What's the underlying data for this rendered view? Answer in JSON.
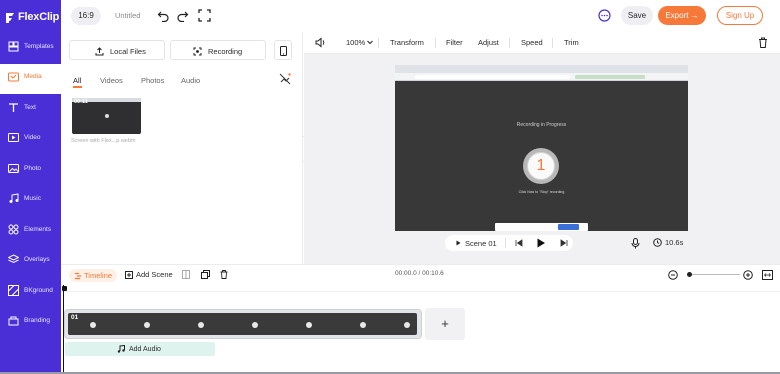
{
  "app": {
    "name": "FlexClip"
  },
  "sidebar": {
    "items": [
      {
        "label": "Templates",
        "icon": "templates-icon"
      },
      {
        "label": "Media",
        "icon": "media-icon"
      },
      {
        "label": "Text",
        "icon": "text-icon"
      },
      {
        "label": "Video",
        "icon": "video-icon"
      },
      {
        "label": "Photo",
        "icon": "photo-icon"
      },
      {
        "label": "Music",
        "icon": "music-icon"
      },
      {
        "label": "Elements",
        "icon": "elements-icon"
      },
      {
        "label": "Overlays",
        "icon": "overlays-icon"
      },
      {
        "label": "BKground",
        "icon": "background-icon"
      },
      {
        "label": "Branding",
        "icon": "branding-icon"
      }
    ],
    "active": "Media"
  },
  "topbar": {
    "ratio": "16:9",
    "title": "Untitled",
    "save_label": "Save",
    "export_label": "Export →",
    "signup_label": "Sign Up"
  },
  "media_panel": {
    "local_files_label": "Local Files",
    "recording_label": "Recording",
    "tabs": [
      "All",
      "Videos",
      "Photos",
      "Audio"
    ],
    "active_tab": "All",
    "item": {
      "duration": "00:11",
      "name": "Screen with Flex...p.webm"
    }
  },
  "editor_toolbar": {
    "zoom": "100%",
    "tools": [
      "Transform",
      "Filter",
      "Adjust",
      "Speed",
      "Trim"
    ]
  },
  "preview": {
    "recording_text": "Recording in Progress",
    "countdown": "1",
    "hint_text": "Click Now to \"Stop\" recording",
    "scene_label": "Scene 01",
    "duration": "10.6s"
  },
  "timeline": {
    "label": "Timeline",
    "add_scene_label": "Add Scene",
    "time": "00:00.0 / 00:10.6",
    "clip_number": "01",
    "add_audio_label": "Add Audio",
    "add_scene_symbol": "+"
  },
  "colors": {
    "brand": "#4a2fd6",
    "accent": "#f7793a"
  }
}
